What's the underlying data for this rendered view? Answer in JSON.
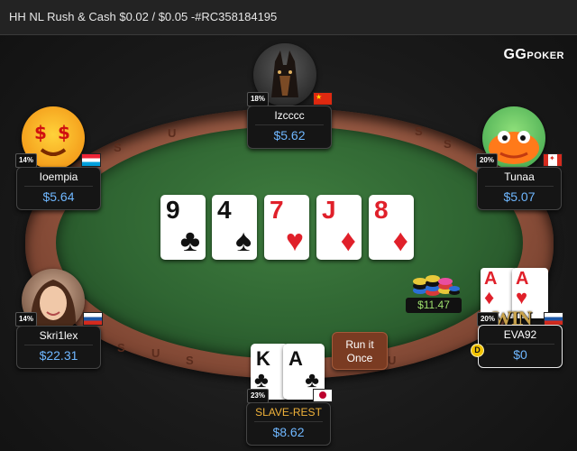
{
  "window": {
    "title": "HH NL Rush & Cash $0.02 / $0.05 -#RC358184195"
  },
  "brand": {
    "logo_gg": "GG",
    "logo_poker": "POKER"
  },
  "table": {
    "rail_letters": [
      "G",
      "S",
      "U",
      "S",
      "U",
      "S",
      "U",
      "S",
      "S"
    ],
    "board": [
      {
        "rank": "9",
        "suit": "♣",
        "color": "black"
      },
      {
        "rank": "4",
        "suit": "♠",
        "color": "black"
      },
      {
        "rank": "7",
        "suit": "♥",
        "color": "red"
      },
      {
        "rank": "J",
        "suit": "♦",
        "color": "red"
      },
      {
        "rank": "8",
        "suit": "♦",
        "color": "red"
      }
    ],
    "pot": "$11.47",
    "dealer_button": "D"
  },
  "players": {
    "top": {
      "name": "Izcccc",
      "stack": "$5.62",
      "pct": "18%",
      "flag": "cn"
    },
    "left_top": {
      "name": "Ioempia",
      "stack": "$5.64",
      "pct": "14%",
      "flag": "lu"
    },
    "right_top": {
      "name": "Tunaa",
      "stack": "$5.07",
      "pct": "20%",
      "flag": "ca"
    },
    "left_bot": {
      "name": "Skri1lex",
      "stack": "$22.31",
      "pct": "14%",
      "flag": "ru"
    },
    "right_bot": {
      "name": "EVA92",
      "stack": "$0",
      "pct": "20%",
      "flag": "ru",
      "cards": [
        {
          "rank": "A",
          "suit": "♦",
          "color": "red"
        },
        {
          "rank": "A",
          "suit": "♥",
          "color": "red"
        }
      ],
      "badge": "WIN"
    },
    "hero": {
      "name": "SLAVE-REST",
      "stack": "$8.62",
      "pct": "23%",
      "flag": "jp",
      "cards": [
        {
          "rank": "K",
          "suit": "♣",
          "color": "black"
        },
        {
          "rank": "A",
          "suit": "♣",
          "color": "black"
        }
      ]
    }
  },
  "actions": {
    "run_it_once_line1": "Run it",
    "run_it_once_line2": "Once"
  },
  "colors": {
    "felt": "#2f6532",
    "rail": "#8b4f3a",
    "stack_text": "#6fb7ff",
    "pot_text": "#9ee06e",
    "hero_name": "#f0b23a"
  }
}
